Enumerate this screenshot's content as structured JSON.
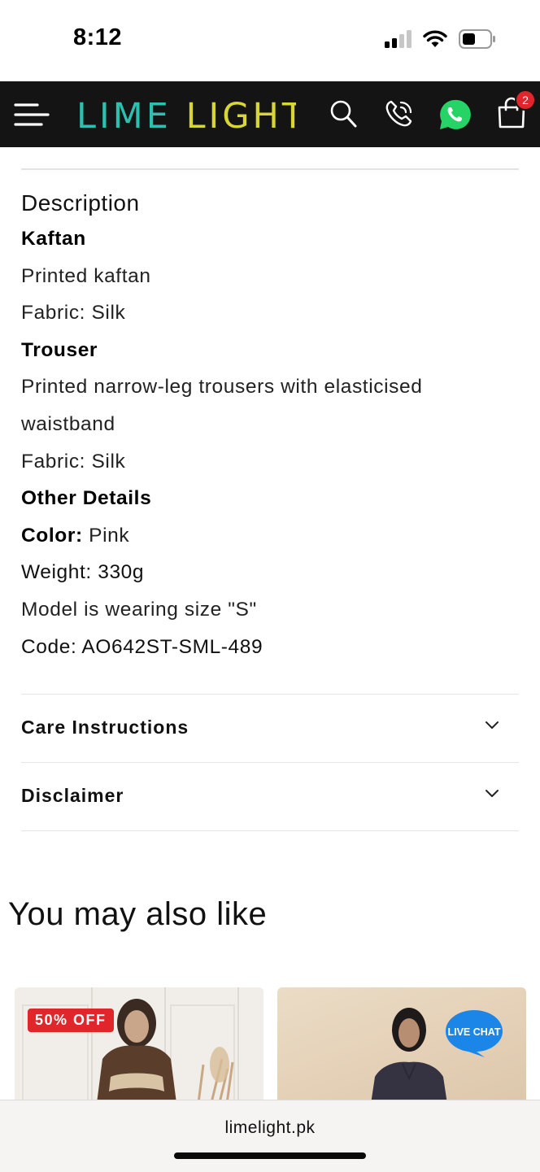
{
  "status_bar": {
    "time": "8:12"
  },
  "header": {
    "brand": "LIMELIGHT",
    "cart_count": "2",
    "colors": {
      "background": "#141414",
      "logo_teal": "#2dbfb0",
      "logo_yellow": "#d7d635",
      "whatsapp": "#25d366",
      "badge": "#e0262b"
    }
  },
  "description": {
    "heading": "Description",
    "kaftan_title": "Kaftan",
    "kaftan_line1": "Printed kaftan",
    "kaftan_fabric": "Fabric: Silk",
    "trouser_title": "Trouser",
    "trouser_line1": "Printed narrow-leg trousers with elasticised",
    "trouser_line2": "waistband",
    "trouser_fabric": "Fabric: Silk",
    "other_title": "Other Details",
    "color_label": "Color:",
    "color_value": " Pink",
    "weight": "Weight: 330g",
    "model_size": "Model is wearing size \"S\"",
    "code": "Code: AO642ST-SML-489"
  },
  "accordions": [
    {
      "title": "Care Instructions"
    },
    {
      "title": "Disclaimer"
    }
  ],
  "recommendations": {
    "title": "You may also like",
    "cards": [
      {
        "badge": "50% OFF"
      },
      {
        "badge": ""
      }
    ],
    "live_chat": "LIVE CHAT"
  },
  "browser": {
    "url": "limelight.pk"
  }
}
